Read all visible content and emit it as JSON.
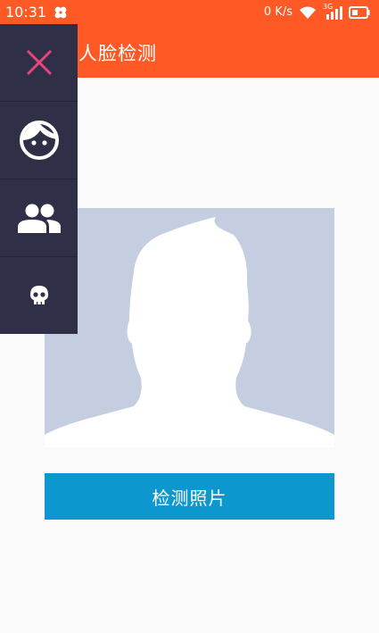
{
  "status_bar": {
    "time": "10:31",
    "network_speed": "0 K/s",
    "cellular": "3G"
  },
  "app_bar": {
    "title": "人脸检测"
  },
  "side_menu": {
    "items": [
      {
        "icon": "close-icon"
      },
      {
        "icon": "face-icon"
      },
      {
        "icon": "group-icon"
      },
      {
        "icon": "skull-icon"
      }
    ]
  },
  "photo": {
    "placeholder_icon": "person-silhouette-icon"
  },
  "detect_button": {
    "label": "检测照片"
  },
  "colors": {
    "primary": "#ff5a26",
    "menu_bg": "#2f3047",
    "accent_blue": "#0c97cf",
    "close_pink": "#e8457c",
    "placeholder_bg": "#c5cde0"
  }
}
